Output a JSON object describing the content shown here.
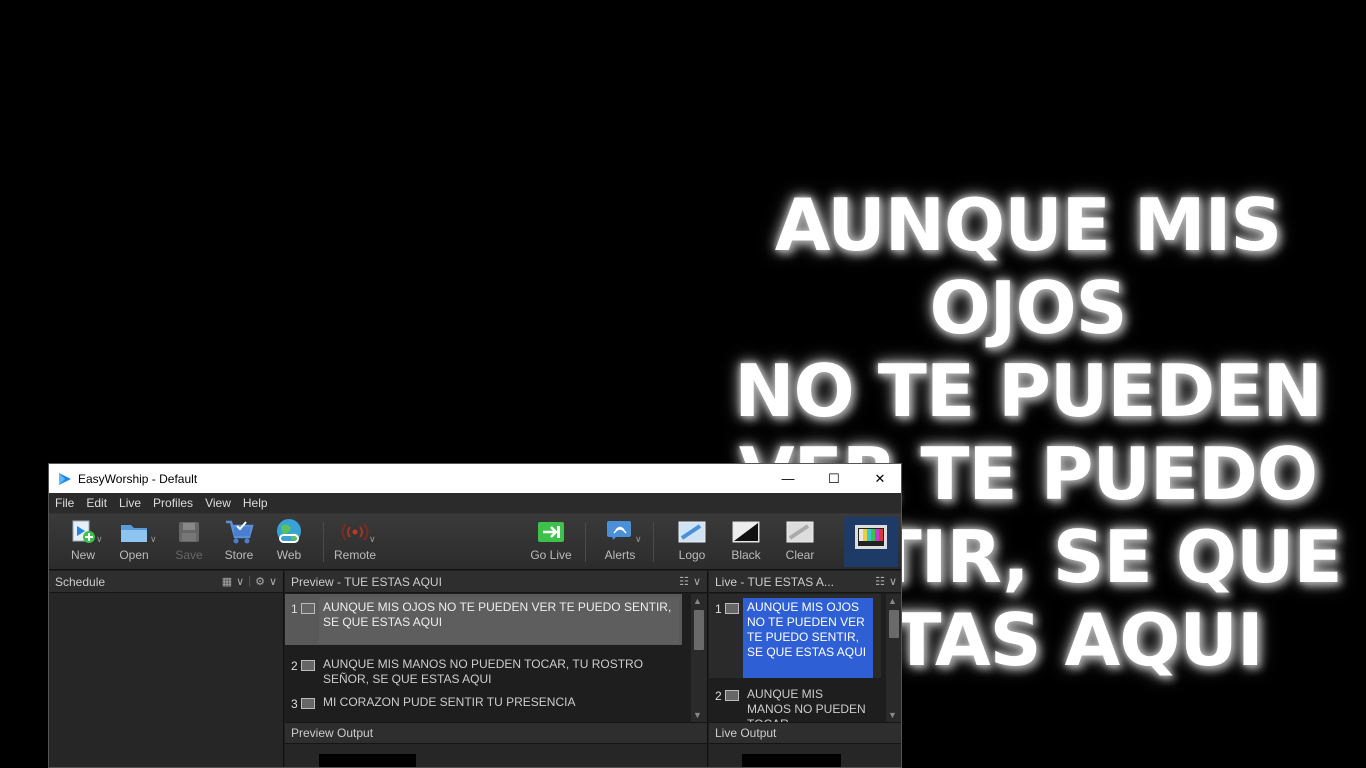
{
  "projection": {
    "lyric": "AUNQUE MIS OJOS\nNO TE PUEDEN\nVER TE PUEDO\nSENTIR, SE QUE\nESTAS AQUI"
  },
  "window": {
    "title": "EasyWorship - Default",
    "controls": {
      "minimize": "—",
      "maximize": "☐",
      "close": "✕"
    }
  },
  "menu": [
    "File",
    "Edit",
    "Live",
    "Profiles",
    "View",
    "Help"
  ],
  "toolbar": {
    "new": "New",
    "open": "Open",
    "save": "Save",
    "store": "Store",
    "web": "Web",
    "remote": "Remote",
    "go_live": "Go Live",
    "alerts": "Alerts",
    "logo": "Logo",
    "black": "Black",
    "clear": "Clear"
  },
  "schedule": {
    "title": "Schedule"
  },
  "preview": {
    "title": "Preview - TUE ESTAS AQUI",
    "slides": [
      {
        "num": "1",
        "text": "AUNQUE MIS OJOS NO TE PUEDEN VER TE PUEDO SENTIR, SE QUE ESTAS AQUI"
      },
      {
        "num": "2",
        "text": "AUNQUE MIS MANOS NO PUEDEN TOCAR, TU ROSTRO SEÑOR, SE QUE ESTAS AQUI"
      },
      {
        "num": "3",
        "text": "MI CORAZON PUDE SENTIR TU PRESENCIA"
      }
    ],
    "output_title": "Preview Output"
  },
  "live": {
    "title": "Live - TUE ESTAS A...",
    "slides": [
      {
        "num": "1",
        "text": "AUNQUE MIS OJOS NO TE PUEDEN VER TE PUEDO SENTIR, SE QUE ESTAS AQUI"
      },
      {
        "num": "2",
        "text": "AUNQUE MIS MANOS NO PUEDEN TOCAR,"
      }
    ],
    "output_title": "Live Output"
  },
  "colors": {
    "live_selected": "#2f5fd4",
    "accent_green": "#3cc24a",
    "remote_red": "#c0392b"
  }
}
